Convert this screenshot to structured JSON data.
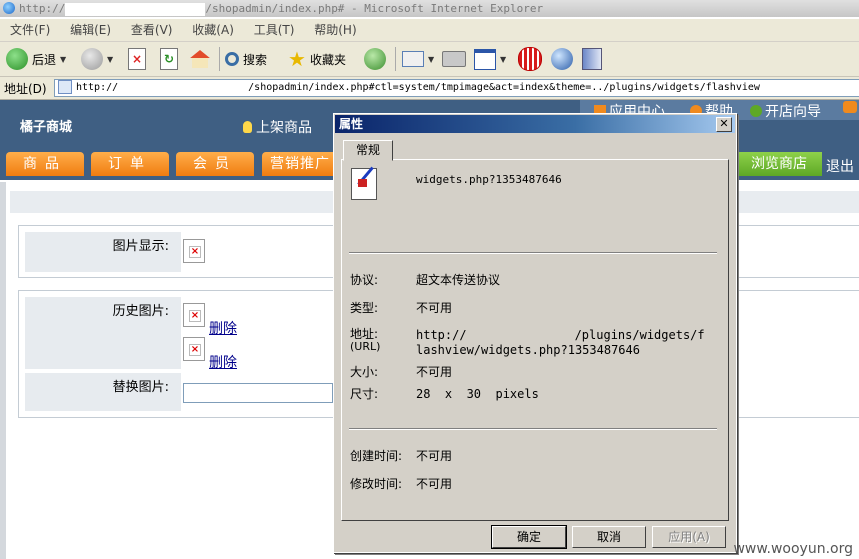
{
  "window": {
    "title_prefix": "http://",
    "title_suffix": "/shopadmin/index.php# - Microsoft Internet Explorer"
  },
  "menu": [
    "文件(F)",
    "编辑(E)",
    "查看(V)",
    "收藏(A)",
    "工具(T)",
    "帮助(H)"
  ],
  "toolbar": {
    "back_label": "后退",
    "search_label": "搜索",
    "favorites_label": "收藏夹"
  },
  "address": {
    "label": "地址(D)",
    "url_prefix": "http://",
    "url_suffix": "/shopadmin/index.php#ctl=system/tmpimage&act=index&theme=../plugins/widgets/flashview"
  },
  "app": {
    "brand": "橘子商城",
    "upload_goods": "上架商品",
    "app_center": "应用中心",
    "help": "帮助",
    "store_wizard": "开店向导",
    "nav": [
      "商品",
      "订单",
      "会员",
      "营销推广"
    ],
    "browse_store": "浏览商店",
    "logout": "退出"
  },
  "form": {
    "image_display_label": "图片显示:",
    "history_image_label": "历史图片:",
    "replace_image_label": "替换图片:",
    "delete_link": "删除"
  },
  "dialog": {
    "title": "属性",
    "tab_general": "常规",
    "file_name": "widgets.php?1353487646",
    "protocol_label": "协议:",
    "protocol_value": "超文本传送协议",
    "type_label": "类型:",
    "type_value": "不可用",
    "address_label": "地址:",
    "address_sub": "(URL)",
    "address_line1_prefix": "http://",
    "address_line1_suffix": "/plugins/widgets/f",
    "address_line2": "lashview/widgets.php?1353487646",
    "size_label": "大小:",
    "size_value": "不可用",
    "dimensions_label": "尺寸:",
    "dimensions_value": "28  x  30  pixels",
    "created_label": "创建时间:",
    "created_value": "不可用",
    "modified_label": "修改时间:",
    "modified_value": "不可用",
    "ok": "确定",
    "cancel": "取消",
    "apply": "应用(A)"
  },
  "watermark": "www.wooyun.org",
  "colors": {
    "header_blue": "#3f5f83",
    "nav_orange": "#f08a1e",
    "browse_green": "#6db52f",
    "dialog_title": "#0a246a"
  }
}
